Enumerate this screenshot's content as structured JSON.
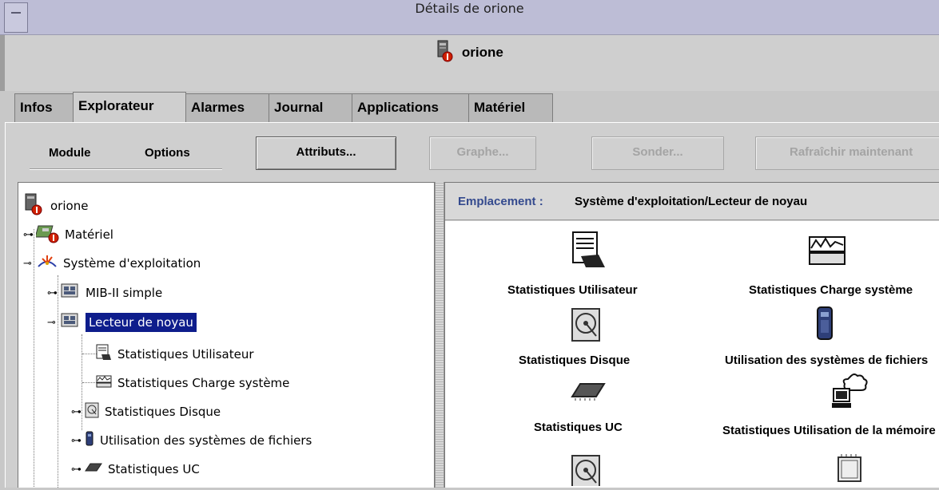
{
  "window": {
    "title": "Détails de orione",
    "host_name": "orione"
  },
  "tabs": [
    {
      "label": "Infos"
    },
    {
      "label": "Explorateur"
    },
    {
      "label": "Alarmes"
    },
    {
      "label": "Journal"
    },
    {
      "label": "Applications"
    },
    {
      "label": "Matériel"
    }
  ],
  "menu": {
    "module": "Module",
    "options": "Options"
  },
  "buttons": {
    "attributes": "Attributs...",
    "graph": "Graphe...",
    "probe": "Sonder...",
    "refresh": "Rafraîchir maintenant"
  },
  "tree": [
    {
      "label": "orione"
    },
    {
      "label": "Matériel"
    },
    {
      "label": "Système d'exploitation"
    },
    {
      "label": "MIB-II simple"
    },
    {
      "label": "Lecteur de noyau"
    },
    {
      "label": "Statistiques Utilisateur"
    },
    {
      "label": "Statistiques Charge système"
    },
    {
      "label": "Statistiques Disque"
    },
    {
      "label": "Utilisation des systèmes de fichiers"
    },
    {
      "label": "Statistiques UC"
    }
  ],
  "location": {
    "label": "Emplacement :",
    "value": "Système d'exploitation/Lecteur de noyau"
  },
  "icons": [
    {
      "caption": "Statistiques Utilisateur"
    },
    {
      "caption": "Statistiques Charge système"
    },
    {
      "caption": "Statistiques Disque"
    },
    {
      "caption": "Utilisation des systèmes de fichiers"
    },
    {
      "caption": "Statistiques UC"
    },
    {
      "caption": "Statistiques Utilisation de la mémoire"
    }
  ],
  "colors": {
    "selection": "#0e1d8c",
    "titlebar": "#bdbdd6",
    "location_label": "#344a8e",
    "alarm": "#d02000"
  }
}
